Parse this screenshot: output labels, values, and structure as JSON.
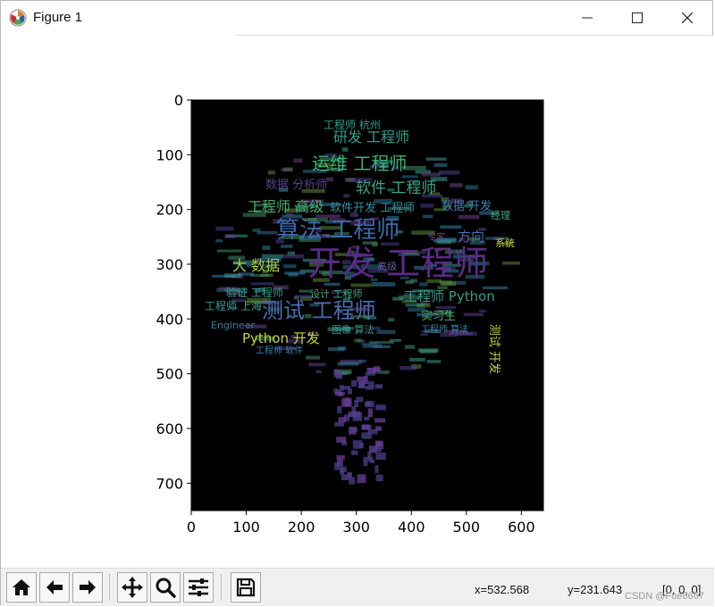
{
  "window": {
    "title": "Figure 1",
    "minimize_glyph": "—",
    "maximize_glyph": "☐",
    "close_glyph": "✕"
  },
  "plot": {
    "y_ticks": [
      "0",
      "100",
      "200",
      "300",
      "400",
      "500",
      "600",
      "700"
    ],
    "x_ticks": [
      "0",
      "100",
      "200",
      "300",
      "400",
      "500",
      "600"
    ],
    "background_color": "#000000",
    "words": [
      {
        "t": "开发 工程师",
        "c": "#5b2a86"
      },
      {
        "t": "算法 工程师",
        "c": "#3a6aa8"
      },
      {
        "t": "测试 工程师",
        "c": "#4a6eb0"
      },
      {
        "t": "运维 工程师",
        "c": "#35b779"
      },
      {
        "t": "研发 工程师",
        "c": "#2e9e8f"
      },
      {
        "t": "软件 工程师",
        "c": "#3ba38a"
      },
      {
        "t": "工程师 高级",
        "c": "#45b070"
      },
      {
        "t": "工程师 Python",
        "c": "#2f9e8e"
      },
      {
        "t": "Python 开发",
        "c": "#c8d43a"
      },
      {
        "t": "大 数据",
        "c": "#a8d13f"
      },
      {
        "t": "数据 开发",
        "c": "#3d7fb0"
      },
      {
        "t": "方向",
        "c": "#4a6eb0"
      },
      {
        "t": "数据 分析师",
        "c": "#5b3f8a"
      },
      {
        "t": "软件开发 工程师",
        "c": "#2f8fa0"
      },
      {
        "t": "工程师 杭州",
        "c": "#2e9e8f"
      },
      {
        "t": "实习生",
        "c": "#46a87a"
      },
      {
        "t": "测试 开发",
        "c": "#bcd33a"
      },
      {
        "t": "验证 工程师",
        "c": "#35a08a"
      },
      {
        "t": "工程师 上海",
        "c": "#3a9a90"
      },
      {
        "t": "设计 工程师",
        "c": "#46a87a"
      },
      {
        "t": "Engineer",
        "c": "#2f7fa8"
      },
      {
        "t": "高级",
        "c": "#6a55a0"
      },
      {
        "t": "系统",
        "c": "#c8d43a"
      },
      {
        "t": "经理",
        "c": "#46a87a"
      },
      {
        "t": "专家",
        "c": "#6a3f8a"
      },
      {
        "t": "图像 算法",
        "c": "#3a9a90"
      },
      {
        "t": "工程师 软件",
        "c": "#3a80a8"
      },
      {
        "t": "工程师 算法",
        "c": "#3a80a8"
      }
    ]
  },
  "toolbar": {
    "home_icon": "home-icon",
    "back_icon": "arrow-left-icon",
    "forward_icon": "arrow-right-icon",
    "pan_icon": "move-icon",
    "zoom_icon": "magnifier-icon",
    "configure_icon": "sliders-icon",
    "save_icon": "floppy-disk-icon",
    "x_readout": "x=532.568",
    "y_readout": "y=231.643",
    "rgb_readout": "[0, 0, 0]"
  },
  "watermark": "CSDN @Fue6667"
}
